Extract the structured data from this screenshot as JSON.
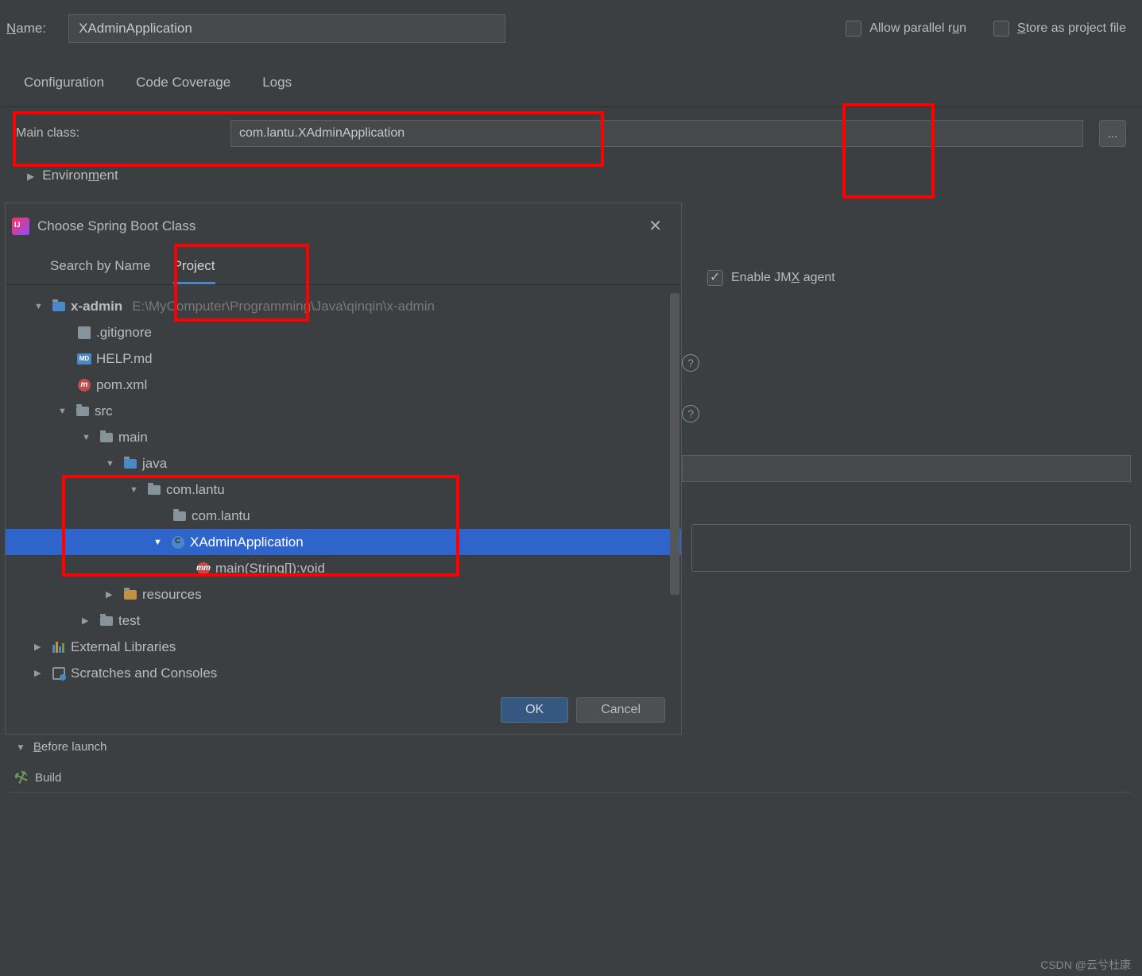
{
  "top": {
    "name_label_pre": "N",
    "name_label_post": "ame:",
    "name_value": "XAdminApplication",
    "parallel_pre": "Allow parallel r",
    "parallel_u": "u",
    "parallel_post": "n",
    "store_pre": "S",
    "store_post": "tore as project file"
  },
  "tabs": {
    "configuration": "Configuration",
    "coverage": "Code Coverage",
    "logs": "Logs"
  },
  "main_class": {
    "label": "Main class:",
    "value": "com.lantu.XAdminApplication",
    "browse": "..."
  },
  "environment": {
    "label_pre": "Environ",
    "label_u": "m",
    "label_post": "ent"
  },
  "jmx": {
    "pre": "Enable JM",
    "u": "X",
    "post": " agent"
  },
  "dialog": {
    "title": "Choose Spring Boot Class",
    "tab_search": "Search by Name",
    "tab_project": "Project",
    "ok": "OK",
    "cancel": "Cancel",
    "help": "?"
  },
  "tree": {
    "root": "x-admin",
    "root_path": "E:\\MyComputer\\Programming\\Java\\qinqin\\x-admin",
    "gitignore": ".gitignore",
    "help_md": "HELP.md",
    "pom": "pom.xml",
    "src": "src",
    "main": "main",
    "java": "java",
    "pkg1": "com.lantu",
    "pkg2": "com.lantu",
    "app_class": "XAdminApplication",
    "main_method": "main(String[]):void",
    "resources": "resources",
    "test": "test",
    "ext_lib": "External Libraries",
    "scratches": "Scratches and Consoles"
  },
  "before_launch": {
    "label_pre": "B",
    "label_post": "efore launch",
    "build": "Build"
  },
  "watermark": "CSDN @云兮杜康"
}
